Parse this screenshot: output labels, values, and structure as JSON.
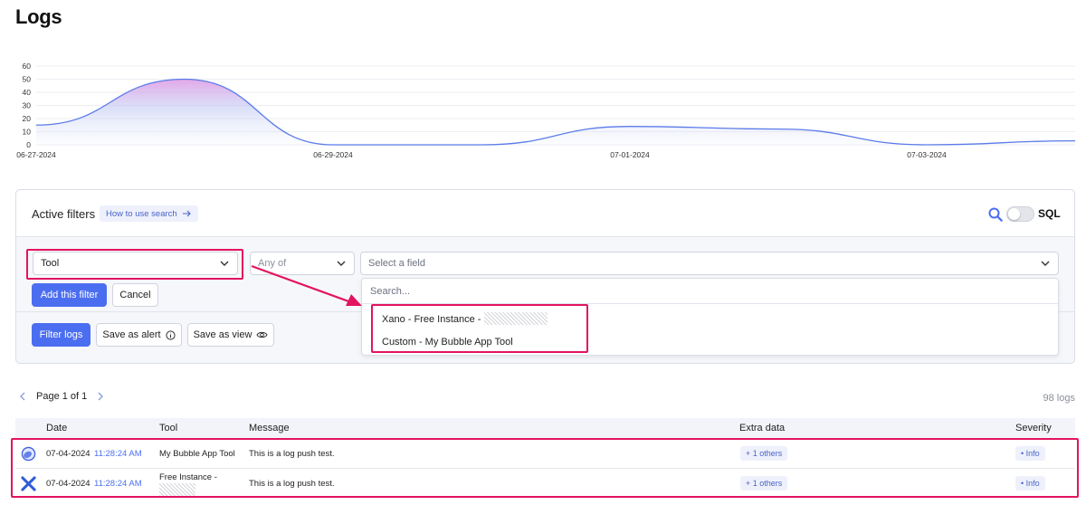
{
  "page": {
    "title": "Logs"
  },
  "chart": {
    "y_ticks": [
      "60",
      "50",
      "40",
      "30",
      "20",
      "10",
      "0"
    ],
    "x_ticks": [
      "06-27-2024",
      "06-29-2024",
      "07-01-2024",
      "07-03-2024"
    ]
  },
  "chart_data": {
    "type": "area",
    "x": [
      "06-27-2024",
      "06-28-2024",
      "06-29-2024",
      "06-30-2024",
      "07-01-2024",
      "07-02-2024",
      "07-03-2024",
      "07-04-2024"
    ],
    "values": [
      15,
      50,
      0,
      0,
      14,
      12,
      0,
      3
    ],
    "ylim": [
      0,
      60
    ],
    "y_ticks": [
      0,
      10,
      20,
      30,
      40,
      50,
      60
    ],
    "x_tick_labels": [
      "06-27-2024",
      "06-29-2024",
      "07-01-2024",
      "07-03-2024"
    ],
    "grid": true,
    "colors": {
      "line": "#5b7be8",
      "fill_top": "#d98be0",
      "fill_bottom": "#dfe6fb"
    }
  },
  "filters": {
    "title": "Active filters",
    "howto_label": "How to use search",
    "sql_label": "SQL",
    "tool_select": "Tool",
    "operator_select": "Any of",
    "field_placeholder": "Select a field",
    "add_filter_label": "Add this filter",
    "cancel_label": "Cancel",
    "filter_logs_label": "Filter logs",
    "save_alert_label": "Save as alert",
    "save_view_label": "Save as view"
  },
  "dropdown": {
    "search_placeholder": "Search...",
    "items": [
      {
        "label": "Xano - Free Instance -"
      },
      {
        "label": "Custom - My Bubble App Tool"
      }
    ]
  },
  "pagination": {
    "label": "Page 1 of 1",
    "count": "98 logs"
  },
  "table": {
    "headers": [
      "Date",
      "Tool",
      "Message",
      "Extra data",
      "Severity"
    ],
    "rows": [
      {
        "date": "07-04-2024",
        "time": "11:28:24 AM",
        "tool": "My Bubble App Tool",
        "message": "This is a log push test.",
        "extra": "+ 1 others",
        "severity": "Info",
        "icon": "bubble-icon"
      },
      {
        "date": "07-04-2024",
        "time": "11:28:24 AM",
        "tool": "Free Instance -",
        "message": "This is a log push test.",
        "extra": "+ 1 others",
        "severity": "Info",
        "icon": "xano-icon"
      }
    ]
  },
  "colors": {
    "accent": "#4b6ef0",
    "highlight": "#e3145f"
  }
}
